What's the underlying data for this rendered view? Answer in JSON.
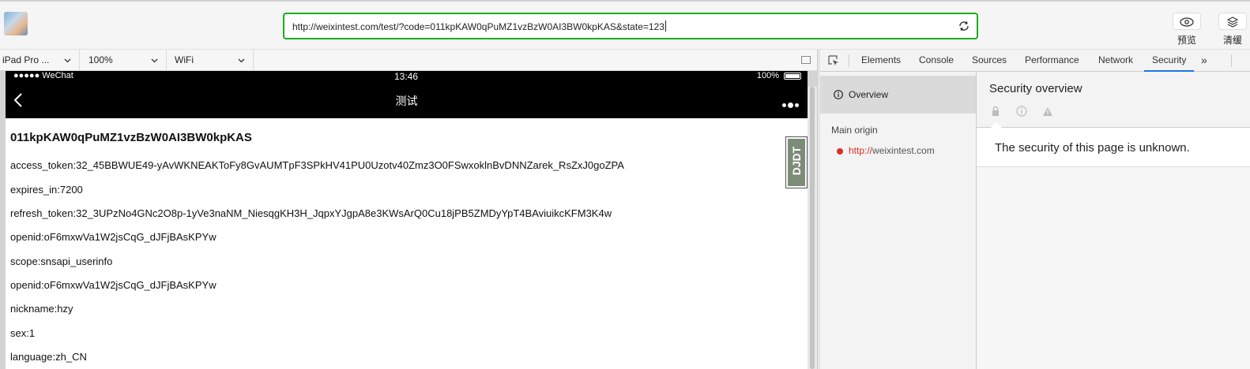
{
  "toolbar": {
    "url": "http://weixintest.com/test/?code=011kpKAW0qPuMZ1vzBzW0AI3BW0kpKAS&state=123",
    "preview_label": "预览",
    "clear_cache_label": "清缓"
  },
  "device_bar": {
    "device": "iPad Pro ...",
    "zoom": "100%",
    "network": "WiFi"
  },
  "phone": {
    "status": {
      "carrier": "●●●●● WeChat",
      "time": "13:46",
      "battery": "100%"
    },
    "nav_title": "测试",
    "heading": "011kpKAW0qPuMZ1vzBzW0AI3BW0kpKAS",
    "lines": [
      "access_token:32_45BBWUE49-yAvWKNEAKToFy8GvAUMTpF3SPkHV41PU0Uzotv40Zmz3O0FSwxoklnBvDNNZarek_RsZxJ0goZPA",
      "expires_in:7200",
      "refresh_token:32_3UPzNo4GNc2O8p-1yVe3naNM_NiesqgKH3H_JqpxYJgpA8e3KWsArQ0Cu18jPB5ZMDyYpT4BAviuikcKFM3K4w",
      "openid:oF6mxwVa1W2jsCqG_dJFjBAsKPYw",
      "scope:snsapi_userinfo",
      "openid:oF6mxwVa1W2jsCqG_dJFjBAsKPYw",
      "nickname:hzy",
      "sex:1",
      "language:zh_CN"
    ],
    "badge": "DJDT"
  },
  "devtools": {
    "tabs": [
      "Elements",
      "Console",
      "Sources",
      "Performance",
      "Network",
      "Security"
    ],
    "active_tab": "Security",
    "overview_label": "Overview",
    "main_origin_label": "Main origin",
    "origin_protocol": "http://",
    "origin_host": "weixintest.com",
    "security_title": "Security overview",
    "security_message": "The security of this page is unknown."
  },
  "colors": {
    "accent_green": "#1aad19",
    "devtools_blue": "#1a73e8",
    "insecure_red": "#d93025"
  }
}
